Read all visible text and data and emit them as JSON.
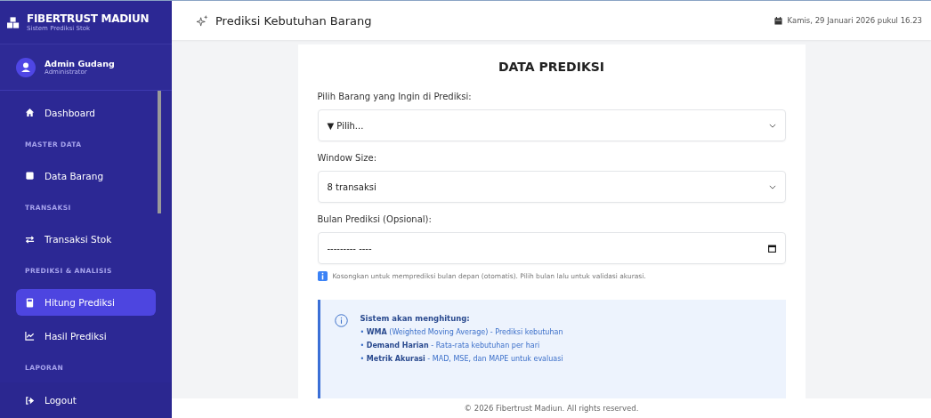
{
  "brand": {
    "title": "FIBERTRUST MADIUN",
    "subtitle": "Sistem Prediksi Stok"
  },
  "user": {
    "name": "Admin Gudang",
    "role": "Administrator"
  },
  "sidebar": {
    "items": [
      {
        "kind": "link",
        "label": "Dashboard",
        "selected": false
      },
      {
        "kind": "section",
        "label": "MASTER DATA"
      },
      {
        "kind": "link",
        "label": "Data Barang",
        "selected": false
      },
      {
        "kind": "section",
        "label": "TRANSAKSI"
      },
      {
        "kind": "link",
        "label": "Transaksi Stok",
        "selected": false
      },
      {
        "kind": "section",
        "label": "PREDIKSI & ANALISIS"
      },
      {
        "kind": "link",
        "label": "Hitung Prediksi",
        "selected": true
      },
      {
        "kind": "link",
        "label": "Hasil Prediksi",
        "selected": false
      },
      {
        "kind": "section",
        "label": "LAPORAN"
      }
    ],
    "logout": "Logout"
  },
  "header": {
    "title": "Prediksi Kebutuhan Barang",
    "date": "Kamis, 29 Januari 2026 pukul 16.23"
  },
  "card": {
    "title": "DATA PREDIKSI",
    "fields": [
      {
        "kind": "select",
        "label": "Pilih Barang yang Ingin di Prediksi:",
        "value": "▼ Pilih..."
      },
      {
        "kind": "select",
        "label": "Window Size:",
        "value": "8 transaksi"
      },
      {
        "kind": "month",
        "label": "Bulan Prediksi (Opsional):",
        "value": "--------- ----",
        "hint": "Kosongkan untuk memprediksi bulan depan (otomatis). Pilih bulan lalu untuk validasi akurasi."
      }
    ],
    "info": {
      "title": "Sistem akan menghitung:",
      "lines": [
        "• **WMA** (Weighted Moving Average) - Prediksi kebutuhan",
        "• **Demand Harian** - Rata-rata kebutuhan per hari",
        "• **Metrik Akurasi** - MAD, MSE, dan MAPE untuk evaluasi"
      ]
    }
  },
  "footer": "© 2026 Fibertrust Madiun. All rights reserved."
}
